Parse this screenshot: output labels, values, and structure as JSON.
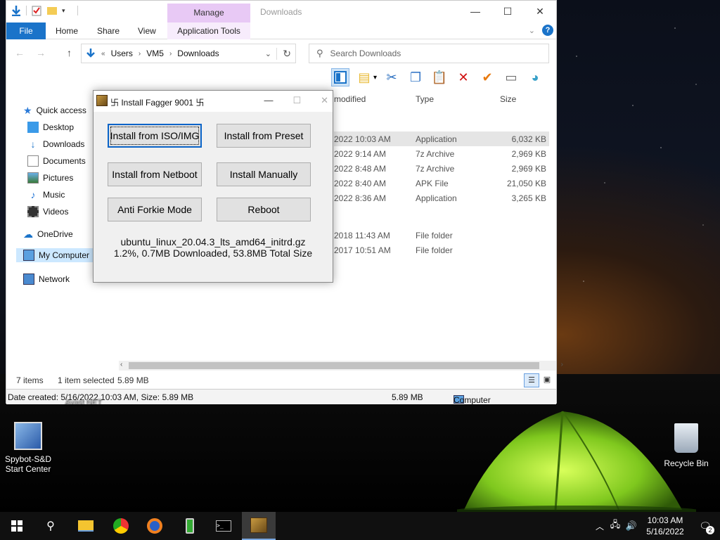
{
  "explorer": {
    "title": "Downloads",
    "manage_tab": "Manage",
    "ribbon": {
      "file": "File",
      "home": "Home",
      "share": "Share",
      "view": "View",
      "app_tools": "Application Tools"
    },
    "address": {
      "crumbs": [
        "Users",
        "VM5",
        "Downloads"
      ]
    },
    "search_placeholder": "Search Downloads",
    "columns": {
      "modified": "modified",
      "type": "Type",
      "size": "Size"
    },
    "sidebar": [
      {
        "label": "Quick access"
      },
      {
        "label": "Desktop"
      },
      {
        "label": "Downloads"
      },
      {
        "label": "Documents"
      },
      {
        "label": "Pictures"
      },
      {
        "label": "Music"
      },
      {
        "label": "Videos"
      },
      {
        "label": "OneDrive"
      },
      {
        "label": "My Computer"
      },
      {
        "label": "Network"
      }
    ],
    "rows": [
      {
        "modified": "2022 10:03 AM",
        "type": "Application",
        "size": "6,032 KB"
      },
      {
        "modified": "2022 9:14 AM",
        "type": "7z Archive",
        "size": "2,969 KB"
      },
      {
        "modified": "2022 8:48 AM",
        "type": "7z Archive",
        "size": "2,969 KB"
      },
      {
        "modified": "2022 8:40 AM",
        "type": "APK File",
        "size": "21,050 KB"
      },
      {
        "modified": "2022 8:36 AM",
        "type": "Application",
        "size": "3,265 KB"
      },
      {
        "modified": "2018 11:43 AM",
        "type": "File folder",
        "size": ""
      },
      {
        "modified": "2017 10:51 AM",
        "type": "File folder",
        "size": ""
      }
    ],
    "status": {
      "items": "7 items",
      "selected": "1 item selected",
      "selected_size": "5.89 MB"
    },
    "details": {
      "info": "Date created: 5/16/2022 10:03 AM, Size: 5.89 MB",
      "size": "5.89 MB",
      "location": "Computer"
    }
  },
  "dialog": {
    "title": "卐 Install Fagger 9001 卐",
    "buttons": {
      "iso": "Install from ISO/IMG",
      "preset": "Install from Preset",
      "netboot": "Install from Netboot",
      "manual": "Install Manually",
      "forkie": "Anti Forkie Mode",
      "reboot": "Reboot"
    },
    "filename": "ubuntu_linux_20.04.3_lts_amd64_initrd.gz",
    "progress_text": "1.2%, 0.7MB Downloaded, 53.8MB Total Size"
  },
  "desktop": {
    "spybot": "Spybot-S&D Start Center",
    "avast_partial": "Avast NET",
    "recycle": "Recycle Bin"
  },
  "taskbar": {
    "time": "10:03 AM",
    "date": "5/16/2022",
    "notifications": "2"
  }
}
